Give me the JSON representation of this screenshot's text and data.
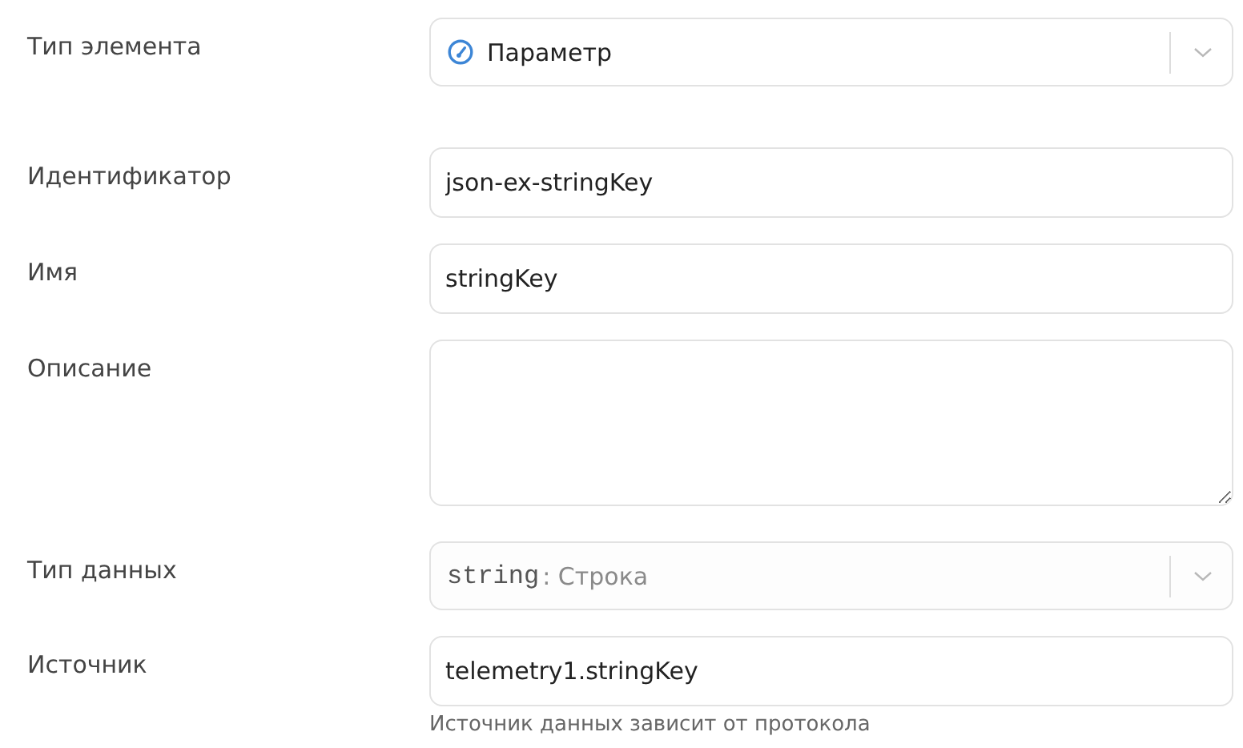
{
  "fields": [
    {
      "kind": "select",
      "label": "Тип элемента",
      "value": "Параметр",
      "icon": true,
      "disabled": false
    },
    {
      "kind": "input",
      "label": "Идентификатор",
      "value": "json-ex-stringKey"
    },
    {
      "kind": "input",
      "label": "Имя",
      "value": "stringKey"
    },
    {
      "kind": "textarea",
      "label": "Описание"
    },
    {
      "kind": "select",
      "label": "Тип данных",
      "code": "string",
      "value": ": Строка",
      "disabled": true
    },
    {
      "kind": "input",
      "label": "Источник",
      "value": "telemetry1.stringKey",
      "hint": "Источник данных зависит от протокола"
    }
  ]
}
